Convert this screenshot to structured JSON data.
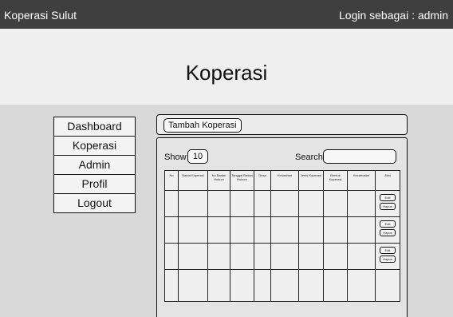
{
  "header": {
    "app_title": "Koperasi Sulut",
    "login_label": "Login sebagai : admin"
  },
  "hero": {
    "title": "Koperasi"
  },
  "sidebar": {
    "items": [
      {
        "label": "Dashboard"
      },
      {
        "label": "Koperasi"
      },
      {
        "label": "Admin"
      },
      {
        "label": "Profil"
      },
      {
        "label": "Logout"
      }
    ]
  },
  "panel": {
    "add_button_label": "Tambah Koperasi",
    "show_label": "Show",
    "show_value": "10",
    "search_label": "Search:",
    "search_value": ""
  },
  "table": {
    "columns": [
      "No",
      "Nama Koperasi",
      "No Badan Hukum",
      "Tanggal Badan Hukum",
      "Desa",
      "Kelurahan",
      "Jenis Koperasi",
      "Bentuk Koperasi",
      "Kecamatan",
      "Aksi"
    ],
    "actions": {
      "edit_label": "Edit",
      "delete_label": "Hapus"
    }
  },
  "colors": {
    "topbar_bg": "#3f3f3f",
    "topbar_text": "#ffffff",
    "hero_bg": "#efefef",
    "content_bg": "#d9d9d9"
  }
}
